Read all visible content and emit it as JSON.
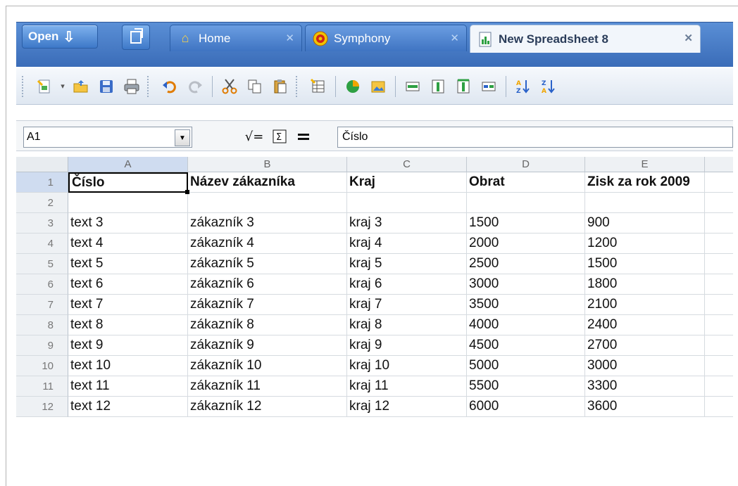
{
  "tabs": {
    "open_label": "Open",
    "items": [
      {
        "label": "Home",
        "icon": "home-icon"
      },
      {
        "label": "Symphony",
        "icon": "symphony-icon"
      },
      {
        "label": "New Spreadsheet 8",
        "icon": "spreadsheet-icon",
        "active": true
      }
    ]
  },
  "formula_bar": {
    "cell_ref": "A1",
    "content": "Číslo"
  },
  "sheet": {
    "columns": [
      "A",
      "B",
      "C",
      "D",
      "E"
    ],
    "rows": [
      [
        "1",
        "Číslo",
        "Název zákazníka",
        "Kraj",
        "Obrat",
        "Zisk za rok 2009"
      ],
      [
        "2",
        "",
        "",
        "",
        "",
        ""
      ],
      [
        "3",
        "text 3",
        "zákazník 3",
        "kraj 3",
        "1500",
        "900"
      ],
      [
        "4",
        "text 4",
        "zákazník 4",
        "kraj 4",
        "2000",
        "1200"
      ],
      [
        "5",
        "text 5",
        "zákazník 5",
        "kraj 5",
        "2500",
        "1500"
      ],
      [
        "6",
        "text 6",
        "zákazník 6",
        "kraj 6",
        "3000",
        "1800"
      ],
      [
        "7",
        "text 7",
        "zákazník 7",
        "kraj 7",
        "3500",
        "2100"
      ],
      [
        "8",
        "text 8",
        "zákazník 8",
        "kraj 8",
        "4000",
        "2400"
      ],
      [
        "9",
        "text 9",
        "zákazník 9",
        "kraj 9",
        "4500",
        "2700"
      ],
      [
        "10",
        "text 10",
        "zákazník 10",
        "kraj 10",
        "5000",
        "3000"
      ],
      [
        "11",
        "text 11",
        "zákazník 11",
        "kraj 11",
        "5500",
        "3300"
      ],
      [
        "12",
        "text 12",
        "zákazník 12",
        "kraj 12",
        "6000",
        "3600"
      ]
    ]
  },
  "colors": {
    "tab_bar": "#3a6cb8",
    "selected_header": "#cfdcf0"
  }
}
